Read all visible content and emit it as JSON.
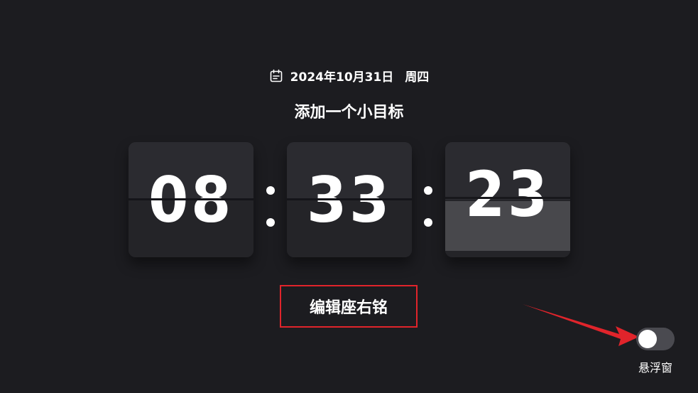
{
  "header": {
    "date": "2024年10月31日",
    "weekday": "周四",
    "goal": "添加一个小目标"
  },
  "clock": {
    "hours": "08",
    "minutes": "33",
    "seconds": "23",
    "separator": ":"
  },
  "actions": {
    "edit_motto_label": "编辑座右铭"
  },
  "floating_window": {
    "label": "悬浮窗",
    "enabled": false
  },
  "icons": {
    "date": "calendar-icon"
  },
  "colors": {
    "background": "#1c1c20",
    "card": "#28282d",
    "highlight_border": "#e0242b",
    "annotation_arrow": "#e0242b"
  }
}
